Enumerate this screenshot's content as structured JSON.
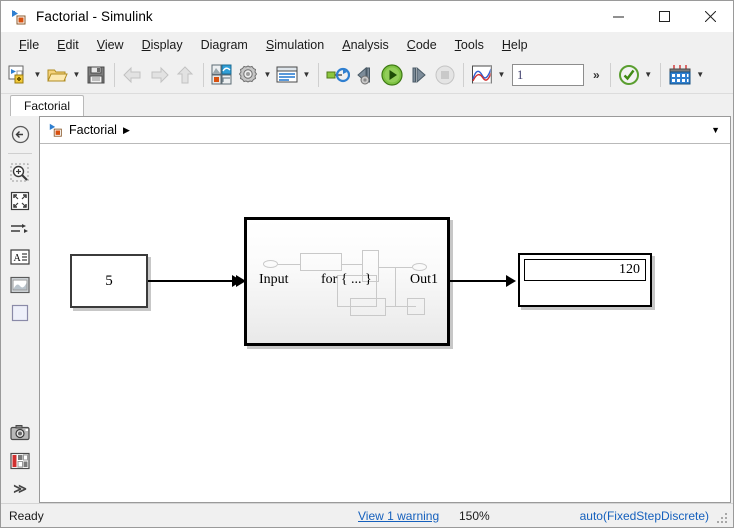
{
  "window": {
    "title": "Factorial - Simulink",
    "icon": "simulink-model-icon",
    "minimize_label": "—",
    "maximize_label": "□",
    "close_label": "✕"
  },
  "menubar": {
    "items": [
      {
        "label": "File",
        "mnemonic": "F"
      },
      {
        "label": "Edit",
        "mnemonic": "E"
      },
      {
        "label": "View",
        "mnemonic": "V"
      },
      {
        "label": "Display",
        "mnemonic": "D"
      },
      {
        "label": "Diagram",
        "mnemonic": "g"
      },
      {
        "label": "Simulation",
        "mnemonic": "S"
      },
      {
        "label": "Analysis",
        "mnemonic": "A"
      },
      {
        "label": "Code",
        "mnemonic": "C"
      },
      {
        "label": "Tools",
        "mnemonic": "T"
      },
      {
        "label": "Help",
        "mnemonic": "H"
      }
    ]
  },
  "toolbar": {
    "new_model": "new-model-icon",
    "new_model_caret": "chevron-down-icon",
    "open": "open-folder-icon",
    "open_caret": "chevron-down-icon",
    "save": "save-disk-icon",
    "back": "back-arrow-icon",
    "forward": "forward-arrow-icon",
    "up": "up-arrow-icon",
    "library_browser": "library-browser-icon",
    "model_config": "gear-icon",
    "model_config_caret": "chevron-down-icon",
    "model_explorer": "model-explorer-icon",
    "model_explorer_caret": "chevron-down-icon",
    "update_model": "update-model-icon",
    "step_back": "step-back-icon",
    "run": "run-play-icon",
    "step_forward": "step-forward-icon",
    "stop": "stop-icon",
    "scope": "scope-signal-icon",
    "scope_caret": "chevron-down-icon",
    "sim_time_value": "1",
    "overflow_label": "»",
    "check_model": "check-circle-icon",
    "check_model_caret": "chevron-down-icon",
    "build": "build-model-icon",
    "build_caret": "chevron-down-icon"
  },
  "tabs": [
    {
      "label": "Factorial",
      "active": true
    }
  ],
  "palette": {
    "items": [
      {
        "name": "navigate-back-icon",
        "label": "Back"
      },
      {
        "name": "zoom-region-icon",
        "label": "Zoom"
      },
      {
        "name": "fit-to-view-icon",
        "label": "Fit to View"
      },
      {
        "name": "signal-ports-icon",
        "label": "Ports"
      },
      {
        "name": "text-annotation-icon",
        "label": "Annotation"
      },
      {
        "name": "image-annotation-icon",
        "label": "Image"
      },
      {
        "name": "area-box-icon",
        "label": "Area"
      },
      {
        "name": "camera-snapshot-icon",
        "label": "Snapshot"
      },
      {
        "name": "layout-legend-icon",
        "label": "Layout"
      }
    ],
    "overflow_label": "≫"
  },
  "breadcrumb": {
    "icon": "simulink-model-icon",
    "path": "Factorial",
    "separator": "▶",
    "caret": "chevron-down-icon"
  },
  "canvas": {
    "blocks": [
      {
        "type": "constant",
        "name": "constant-block",
        "value": "5"
      },
      {
        "type": "subsystem",
        "name": "for-iterator-subsystem-block",
        "input_label": "Input",
        "body_label": "for { ... }",
        "output_label": "Out1"
      },
      {
        "type": "display",
        "name": "display-block",
        "value": "120"
      }
    ]
  },
  "statusbar": {
    "status": "Ready",
    "warning": "View 1 warning",
    "zoom": "150%",
    "solver": "auto(FixedStepDiscrete)"
  }
}
